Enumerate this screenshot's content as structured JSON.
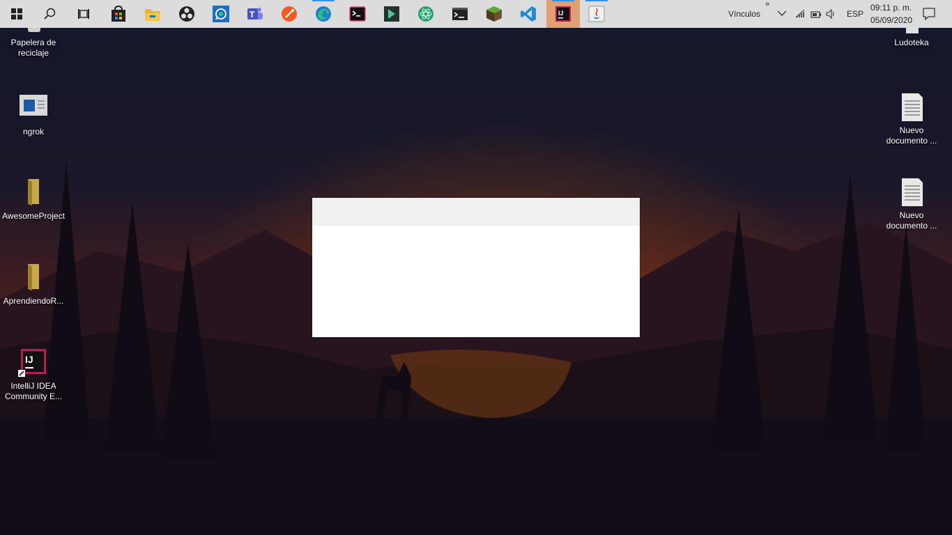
{
  "taskbar": {
    "apps": [
      {
        "name": "start-button-icon"
      },
      {
        "name": "search-icon"
      },
      {
        "name": "task-view-icon"
      },
      {
        "name": "store-icon"
      },
      {
        "name": "file-explorer-icon"
      },
      {
        "name": "obs-icon"
      },
      {
        "name": "whatsapp-icon"
      },
      {
        "name": "teams-icon"
      },
      {
        "name": "postman-icon"
      },
      {
        "name": "edge-icon"
      },
      {
        "name": "terminal-icon"
      },
      {
        "name": "arrow-app-icon"
      },
      {
        "name": "atom-icon"
      },
      {
        "name": "command-prompt-icon"
      },
      {
        "name": "minecraft-icon"
      },
      {
        "name": "vscode-icon"
      },
      {
        "name": "intellij-icon"
      },
      {
        "name": "java-icon"
      }
    ],
    "links_label": "Vínculos",
    "language": "ESP",
    "time": "09:11 p. m.",
    "date": "05/09/2020"
  },
  "desktop": {
    "left_icons": [
      {
        "label_line1": "Papelera de",
        "label_line2": "reciclaje"
      },
      {
        "label_line1": "ngrok",
        "label_line2": ""
      },
      {
        "label_line1": "AwesomeProject",
        "label_line2": ""
      },
      {
        "label_line1": "AprendiendoR...",
        "label_line2": ""
      },
      {
        "label_line1": "IntelliJ IDEA",
        "label_line2": "Community E..."
      }
    ],
    "right_icons": [
      {
        "label_line1": "Ludoteka",
        "label_line2": ""
      },
      {
        "label_line1": "Nuevo",
        "label_line2": "documento ..."
      },
      {
        "label_line1": "Nuevo",
        "label_line2": "documento ..."
      }
    ]
  },
  "colors": {
    "taskbar_bg": "#dcdcdc",
    "active_app_bg": "#e0a071",
    "dialog_bg": "#ffffff",
    "dialog_titlebar_bg": "#f0f0f0"
  }
}
